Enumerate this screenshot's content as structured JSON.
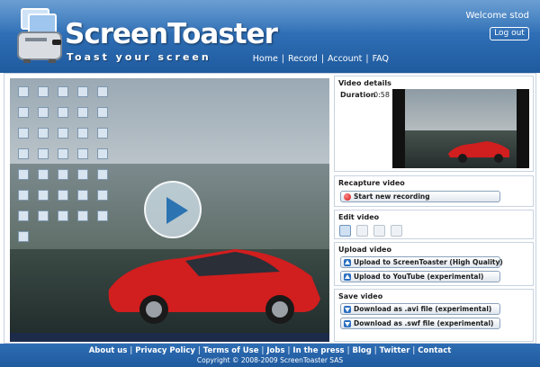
{
  "header": {
    "logo_title": "ScreenToaster",
    "tagline": "Toast your screen",
    "welcome": "Welcome stod",
    "logout_label": "Log out",
    "nav": [
      "Home",
      "Record",
      "Account",
      "FAQ"
    ]
  },
  "video_details": {
    "title": "Video details",
    "duration_label": "Duration",
    "duration_value": "0:58"
  },
  "recapture": {
    "title": "Recapture video",
    "button_label": "Start new recording"
  },
  "edit": {
    "title": "Edit video",
    "icons": [
      "comment-icon",
      "mute-icon",
      "camera-icon",
      "microphone-icon"
    ]
  },
  "upload": {
    "title": "Upload video",
    "buttons": [
      "Upload to ScreenToaster (High Quality)",
      "Upload to YouTube (experimental)"
    ]
  },
  "save": {
    "title": "Save video",
    "buttons": [
      "Download as .avi file (experimental)",
      "Download as .swf file (experimental)"
    ]
  },
  "footer": {
    "links": [
      "About us",
      "Privacy Policy",
      "Terms of Use",
      "Jobs",
      "In the press",
      "Blog",
      "Twitter",
      "Contact"
    ],
    "copyright": "Copyright © 2008-2009 ScreenToaster SAS"
  },
  "colors": {
    "header_blue": "#2f6fb6",
    "record_red": "#d01010",
    "button_blue": "#2a6fc0"
  }
}
